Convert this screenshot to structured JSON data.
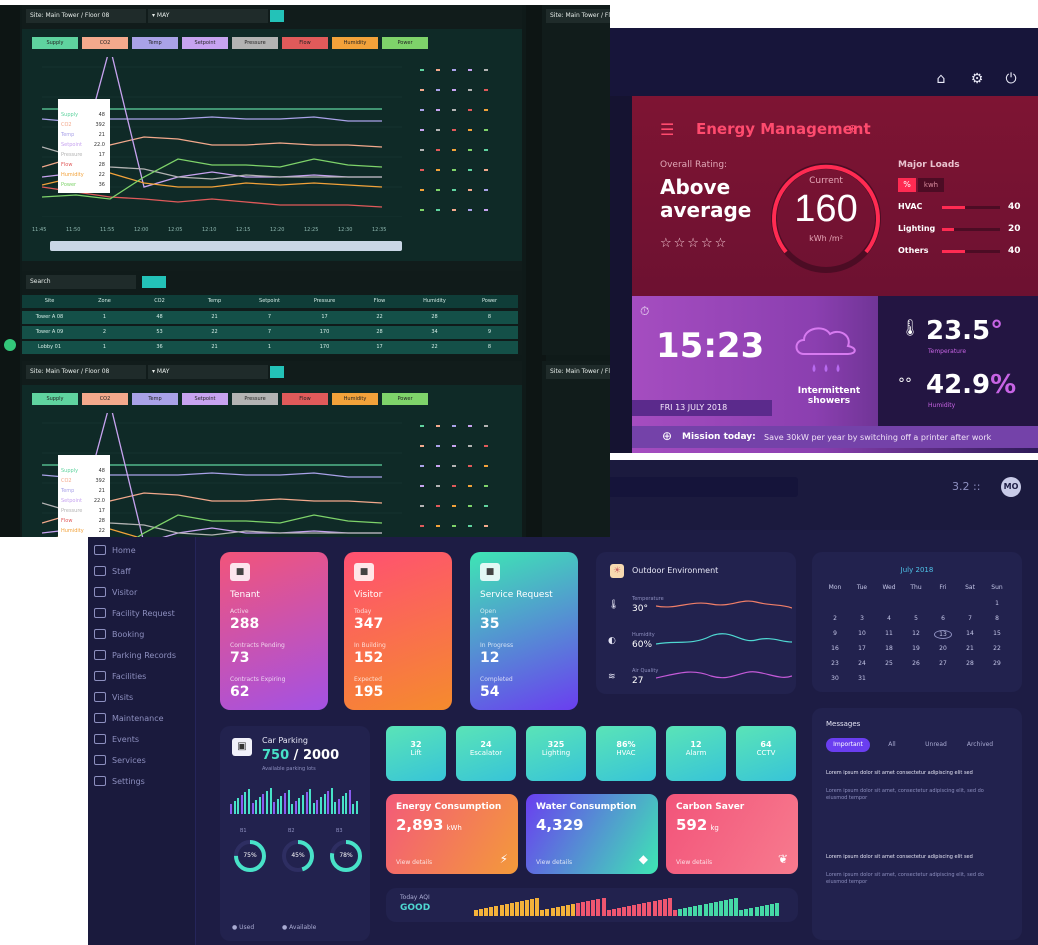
{
  "dashboard": {
    "topbar": {
      "right_text": "3.2  ::",
      "avatar": "MO"
    },
    "sidebar": {
      "items": [
        "Home",
        "Staff",
        "Visitor",
        "Facility Request",
        "Booking",
        "Parking Records",
        "Facilities",
        "Visits",
        "Maintenance",
        "Events",
        "Services",
        "Settings"
      ]
    },
    "cards": [
      {
        "title": "Tenant",
        "icon": "users-icon",
        "rows": [
          {
            "label": "Active",
            "value": "288"
          },
          {
            "label": "Contracts Pending",
            "value": "73"
          },
          {
            "label": "Contracts Expiring",
            "value": "62"
          }
        ],
        "gradient": [
          "#f2547a",
          "#a352e4"
        ]
      },
      {
        "title": "Visitor",
        "icon": "visitor-icon",
        "rows": [
          {
            "label": "Today",
            "value": "347"
          },
          {
            "label": "In Building",
            "value": "152"
          },
          {
            "label": "Expected",
            "value": "195"
          }
        ],
        "gradient": [
          "#ff5072",
          "#f58b2d"
        ]
      },
      {
        "title": "Service Request",
        "icon": "tool-icon",
        "rows": [
          {
            "label": "Open",
            "value": "35"
          },
          {
            "label": "In Progress",
            "value": "12"
          },
          {
            "label": "Completed",
            "value": "54"
          }
        ],
        "gradient": [
          "#3ee6b4",
          "#6a3ef0"
        ]
      }
    ],
    "outdoor": {
      "title": "Outdoor Environment",
      "rows": [
        {
          "label": "Temperature",
          "value": "30°"
        },
        {
          "label": "Humidity",
          "value": "60%"
        },
        {
          "label": "Air Quality",
          "value": "27"
        }
      ]
    },
    "calendar": {
      "month": "July 2018",
      "weekdays": [
        "Mon",
        "Tue",
        "Wed",
        "Thu",
        "Fri",
        "Sat",
        "Sun"
      ],
      "days": [
        "",
        "",
        "",
        "",
        "",
        "",
        "1",
        "2",
        "3",
        "4",
        "5",
        "6",
        "7",
        "8",
        "9",
        "10",
        "11",
        "12",
        "13",
        "14",
        "15",
        "16",
        "17",
        "18",
        "19",
        "20",
        "21",
        "22",
        "23",
        "24",
        "25",
        "26",
        "27",
        "28",
        "29",
        "30",
        "31"
      ]
    },
    "parking": {
      "title": "Car Parking",
      "used": "750",
      "total": "2000",
      "sub": "Available parking lots",
      "rings": [
        {
          "label": "B1",
          "value": "75%"
        },
        {
          "label": "B2",
          "value": "45%"
        },
        {
          "label": "B3",
          "value": "78%"
        }
      ],
      "legend": [
        "Used",
        "Available"
      ]
    },
    "tiles": [
      {
        "value": "32",
        "label": "Lift"
      },
      {
        "value": "24",
        "label": "Escalator"
      },
      {
        "value": "325",
        "label": "Lighting"
      },
      {
        "value": "86%",
        "label": "HVAC"
      },
      {
        "value": "12",
        "label": "Alarm"
      },
      {
        "value": "64",
        "label": "CCTV"
      }
    ],
    "stats": [
      {
        "title": "Energy Consumption",
        "value": "2,893",
        "unit": "kWh",
        "foot": "View details",
        "icon": "plug-icon",
        "gradient": [
          "#f35a79",
          "#f39a3a"
        ]
      },
      {
        "title": "Water Consumption",
        "value": "4,329",
        "unit": "",
        "foot": "View details",
        "icon": "drop-icon",
        "gradient": [
          "#6a3ef0",
          "#3ee6b4"
        ]
      },
      {
        "title": "Carbon Saver",
        "value": "592",
        "unit": "kg",
        "foot": "View details",
        "icon": "leaf-icon",
        "gradient": [
          "#f2547a",
          "#f77b8e"
        ]
      }
    ],
    "air": {
      "label": "Today AQI",
      "value": "GOOD"
    },
    "messages": {
      "title": "Messages",
      "tabs": [
        "Important",
        "All",
        "Unread",
        "Archived"
      ],
      "items": [
        {
          "title": "Lorem ipsum dolor sit amet consectetur adipiscing elit sed",
          "body": "Lorem ipsum dolor sit amet, consectetur adipiscing elit, sed do eiusmod tempor"
        },
        {
          "title": "Lorem ipsum dolor sit amet consectetur adipiscing elit sed",
          "body": "Lorem ipsum dolor sit amet, consectetur adipiscing elit, sed do eiusmod tempor"
        }
      ]
    }
  },
  "energy": {
    "title": "Energy Management",
    "rating_label": "Overall Rating:",
    "rating_value_line1": "Above",
    "rating_value_line2": "average",
    "stars_filled": 0,
    "stars_total": 5,
    "current_label": "Current",
    "current_value": "160",
    "current_unit": "kWh /m²",
    "major_loads_title": "Major Loads",
    "major_loads_toggle": [
      "%",
      "kwh"
    ],
    "loads": [
      {
        "name": "HVAC",
        "value": "40",
        "fraction": 0.4
      },
      {
        "name": "Lighting",
        "value": "20",
        "fraction": 0.2
      },
      {
        "name": "Others",
        "value": "40",
        "fraction": 0.4
      }
    ],
    "time": "15:23",
    "date": "FRI 13 JULY 2018",
    "weather": "Intermittent showers",
    "temperature": "23.5",
    "temperature_unit": "°",
    "temperature_label": "Temperature",
    "humidity": "42.9",
    "humidity_unit": "%",
    "humidity_label": "Humidity",
    "mission_label": "Mission today:",
    "mission_text": "Save 30kW per year by switching off a printer after work",
    "nav_icons": [
      "home-icon",
      "settings-icon",
      "power-icon"
    ]
  },
  "monitor": {
    "select1": "Site: Main Tower / Floor 08",
    "select2": "▾ MAY",
    "legend_chips": [
      "Supply",
      "CO2",
      "Temp",
      "Setpoint",
      "Pressure",
      "Flow",
      "Humidity",
      "Power"
    ],
    "chip_colors": [
      "#5fd39f",
      "#f3a98c",
      "#a9a2e8",
      "#c7a3f0",
      "#b3b3b3",
      "#e05a5a",
      "#f2a23a",
      "#7ed36a"
    ],
    "legend_rows": [
      {
        "name": "Supply",
        "value": "48"
      },
      {
        "name": "CO2",
        "value": "392"
      },
      {
        "name": "Temp",
        "value": "21"
      },
      {
        "name": "Setpoint",
        "value": "22.0"
      },
      {
        "name": "Pressure",
        "value": "17"
      },
      {
        "name": "Flow",
        "value": "28"
      },
      {
        "name": "Humidity",
        "value": "22"
      },
      {
        "name": "Power",
        "value": "36"
      }
    ],
    "x_ticks": [
      "11:45",
      "11:50",
      "11:55",
      "12:00",
      "12:05",
      "12:10",
      "12:15",
      "12:20",
      "12:25",
      "12:30",
      "12:35"
    ],
    "table_search": "Search",
    "table_headers": [
      "Site",
      "Zone",
      "CO2",
      "Temp",
      "Setpoint",
      "Pressure",
      "Flow",
      "Humidity",
      "Power"
    ],
    "table_rows": [
      [
        "Tower A 08",
        "1",
        "48",
        "21",
        "7",
        "17",
        "22",
        "28",
        "8"
      ],
      [
        "Tower A 09",
        "2",
        "53",
        "22",
        "7",
        "170",
        "28",
        "34",
        "9"
      ],
      [
        "Lobby 01",
        "1",
        "36",
        "21",
        "1",
        "170",
        "17",
        "22",
        "8"
      ]
    ]
  }
}
